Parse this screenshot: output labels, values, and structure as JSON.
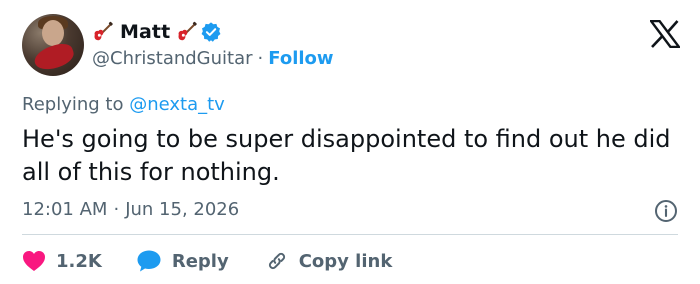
{
  "author": {
    "display_name": "Matt",
    "handle": "@ChristandGuitar",
    "separator": "·",
    "follow_label": "Follow"
  },
  "reply": {
    "prefix": "Replying to",
    "mention": "@nexta_tv"
  },
  "tweet": {
    "text": "He's going to be super disappointed to find out he did all of this for nothing."
  },
  "meta": {
    "time": "12:01 AM",
    "separator": "·",
    "date": "Jun 15, 2026"
  },
  "actions": {
    "likes_count": "1.2K",
    "reply_label": "Reply",
    "copy_link_label": "Copy link"
  },
  "colors": {
    "accent": "#1d9bf0",
    "like": "#f91880",
    "muted": "#536471",
    "text": "#0f1419"
  },
  "icons": [
    "guitar-emoji-icon",
    "verified-badge-icon",
    "x-logo-icon",
    "info-icon",
    "heart-icon",
    "reply-bubble-icon",
    "link-icon"
  ]
}
